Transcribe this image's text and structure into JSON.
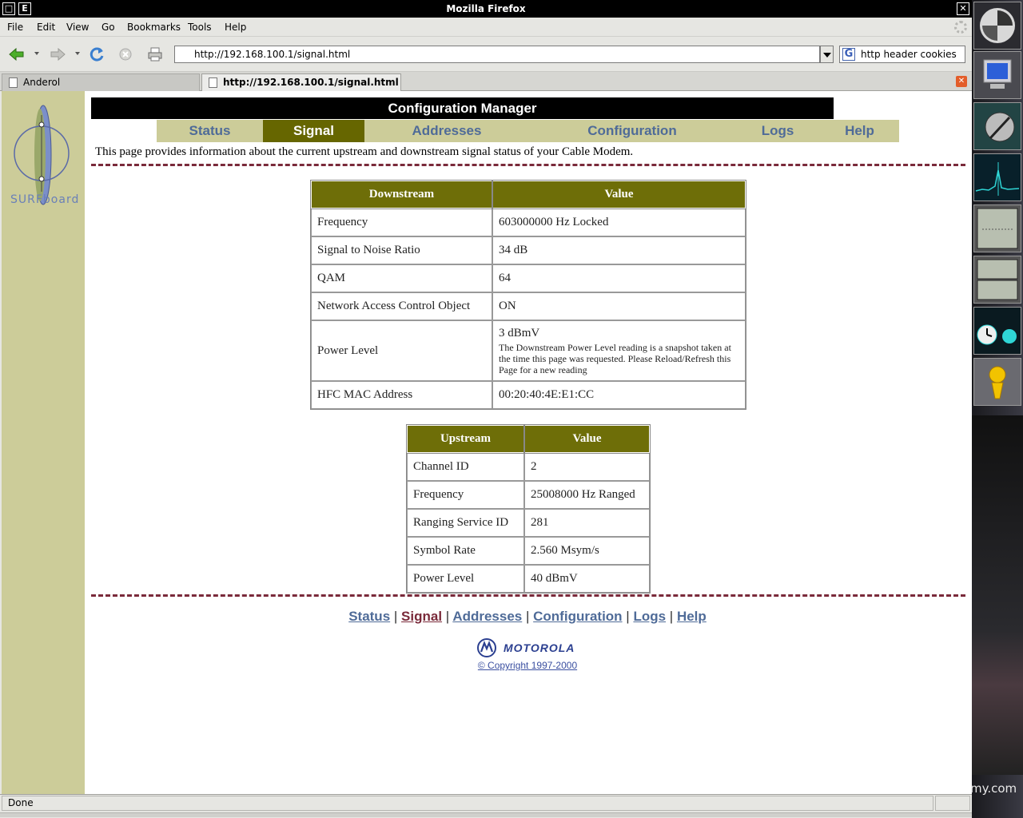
{
  "window": {
    "title": "Mozilla Firefox"
  },
  "menu": {
    "items": [
      "File",
      "Edit",
      "View",
      "Go",
      "Bookmarks",
      "Tools",
      "Help"
    ]
  },
  "toolbar": {
    "url": "http://192.168.100.1/signal.html",
    "search_value": "http header cookies"
  },
  "tabs": [
    {
      "label": "Anderol"
    },
    {
      "label": "http://192.168.100.1/signal.html"
    }
  ],
  "page": {
    "header": "Configuration Manager",
    "nav": [
      "Status",
      "Signal",
      "Addresses",
      "Configuration",
      "Logs",
      "Help"
    ],
    "active_nav": "Signal",
    "intro": "This page provides information about the current upstream and downstream signal status of your Cable Modem.",
    "logo_text": "SURFboard",
    "downstream": {
      "headers": [
        "Downstream",
        "Value"
      ],
      "rows": [
        {
          "label": "Frequency",
          "value": "603000000 Hz Locked"
        },
        {
          "label": "Signal to Noise Ratio",
          "value": "34 dB"
        },
        {
          "label": "QAM",
          "value": "64"
        },
        {
          "label": "Network Access Control Object",
          "value": "ON"
        },
        {
          "label": "Power Level",
          "value": "3 dBmV",
          "note": "The Downstream Power Level reading is a snapshot taken at the time this page was requested. Please Reload/Refresh this Page for a new reading"
        },
        {
          "label": "HFC MAC Address",
          "value": "00:20:40:4E:E1:CC"
        }
      ]
    },
    "upstream": {
      "headers": [
        "Upstream",
        "Value"
      ],
      "rows": [
        {
          "label": "Channel ID",
          "value": "2"
        },
        {
          "label": "Frequency",
          "value": "25008000 Hz Ranged"
        },
        {
          "label": "Ranging Service ID",
          "value": "281"
        },
        {
          "label": "Symbol Rate",
          "value": "2.560 Msym/s"
        },
        {
          "label": "Power Level",
          "value": "40 dBmV"
        }
      ]
    },
    "footer": {
      "links": [
        "Status",
        "Signal",
        "Addresses",
        "Configuration",
        "Logs",
        "Help"
      ],
      "brand": "MOTOROLA",
      "copyright": "© Copyright 1997-2000"
    }
  },
  "status": {
    "text": "Done"
  },
  "dock": {
    "watermark": "my.com"
  },
  "colors": {
    "accent": "#666600",
    "nav_bg": "#cccc99",
    "link": "#4f6b98",
    "divider": "#7a2a3a"
  }
}
